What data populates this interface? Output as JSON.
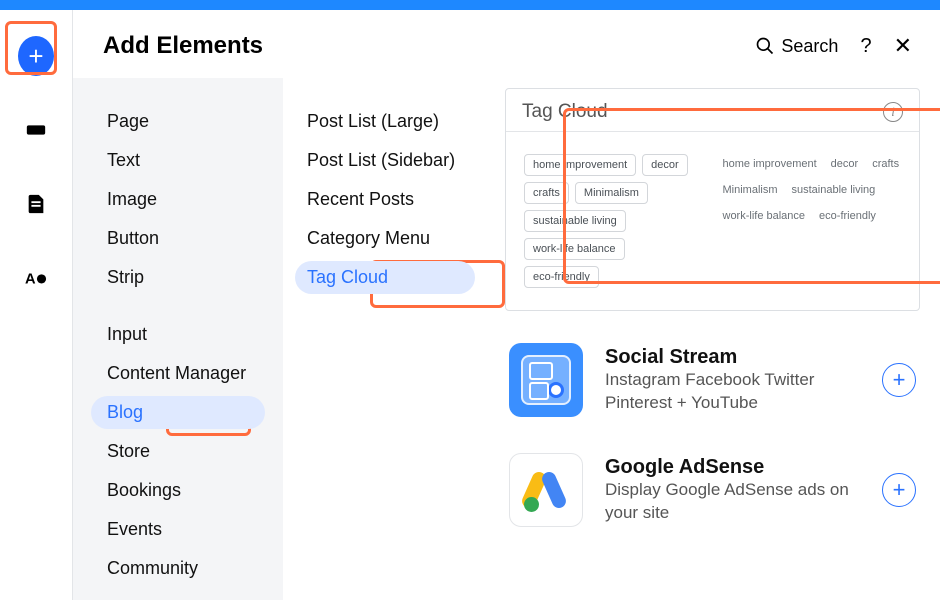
{
  "header": {
    "title": "Add Elements",
    "search_label": "Search",
    "help": "?",
    "close": "✕"
  },
  "rail": {
    "plus_glyph": "+",
    "icons": [
      "section-icon",
      "page-icon",
      "design-icon"
    ]
  },
  "categories": {
    "group1": [
      "Page",
      "Text",
      "Image",
      "Button",
      "Strip"
    ],
    "group2": [
      "Input",
      "Content Manager",
      "Blog",
      "Store",
      "Bookings",
      "Events",
      "Community"
    ],
    "selected": "Blog"
  },
  "subcategories": {
    "items": [
      "Post List (Large)",
      "Post List (Sidebar)",
      "Recent Posts",
      "Category Menu",
      "Tag Cloud"
    ],
    "selected": "Tag Cloud"
  },
  "preview": {
    "title": "Tag Cloud",
    "left_tags": [
      "home improvement",
      "decor",
      "crafts",
      "Minimalism",
      "sustainable living",
      "work-life balance",
      "eco-friendly"
    ],
    "right_rows": [
      [
        "home improvement",
        "decor",
        "crafts"
      ],
      [
        "Minimalism",
        "sustainable living"
      ],
      [
        "work-life balance",
        "eco-friendly"
      ]
    ]
  },
  "promos": [
    {
      "title": "Social Stream",
      "desc": "Instagram Facebook Twitter Pinterest + YouTube"
    },
    {
      "title": "Google AdSense",
      "desc": "Display Google AdSense ads on your site"
    }
  ]
}
